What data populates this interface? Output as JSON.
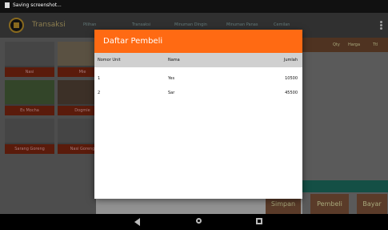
{
  "status_bar": {
    "text": "Saving screenshot..."
  },
  "app_bar": {
    "title": "Transaksi",
    "tabs": [
      "Pilihan",
      "Transaksi",
      "Minuman Dingin",
      "Minuman Panas",
      "Cemilan"
    ]
  },
  "menu_grid": {
    "items": [
      "Nasi",
      "Mie",
      "Es Mocha",
      "Dogmie",
      "Sarang Goreng",
      "Nasi Goreng"
    ]
  },
  "right_panel": {
    "header": [
      "Qty",
      "Harga",
      "Ttl"
    ],
    "buttons": [
      "Simpan",
      "Pembeli",
      "Bayar"
    ]
  },
  "dialog": {
    "title": "Daftar Pembeli",
    "columns": [
      "Nomor Unit",
      "Nama",
      "Jumlah"
    ],
    "rows": [
      {
        "nomor": "1",
        "nama": "Yes",
        "jumlah": "10500"
      },
      {
        "nomor": "2",
        "nama": "Sar",
        "jumlah": "45500"
      }
    ]
  },
  "colors": {
    "accent": "#ff6a13",
    "appbar": "#4a4a4a",
    "status": "#111111",
    "nav": "#000000"
  }
}
